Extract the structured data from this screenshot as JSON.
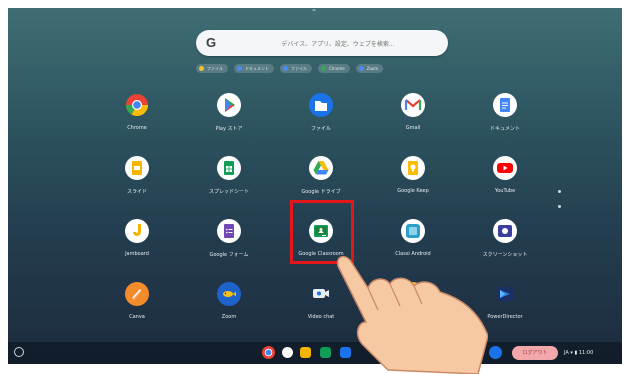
{
  "search": {
    "g_letter": "G",
    "placeholder": "デバイス、アプリ、設定、ウェブを検索..."
  },
  "chips": [
    {
      "label": "ファイル",
      "color": "#f6c026"
    },
    {
      "label": "ドキュメント",
      "color": "#4a8af4"
    },
    {
      "label": "ファイル",
      "color": "#4a8af4"
    },
    {
      "label": "Chrome",
      "color": "#34a853"
    },
    {
      "label": "Zoom",
      "color": "#4a8af4"
    }
  ],
  "apps": [
    {
      "name": "chrome",
      "label": "Chrome",
      "icon": "chrome-icon"
    },
    {
      "name": "play-store",
      "label": "Play ストア",
      "icon": "play-store-icon"
    },
    {
      "name": "files",
      "label": "ファイル",
      "icon": "files-icon"
    },
    {
      "name": "gmail",
      "label": "Gmail",
      "icon": "gmail-icon"
    },
    {
      "name": "docs",
      "label": "ドキュメント",
      "icon": "docs-icon"
    },
    {
      "name": "slides",
      "label": "スライド",
      "icon": "slides-icon"
    },
    {
      "name": "sheets",
      "label": "スプレッドシート",
      "icon": "sheets-icon"
    },
    {
      "name": "google-drive",
      "label": "Google ドライブ",
      "icon": "drive-icon"
    },
    {
      "name": "google-keep",
      "label": "Google Keep",
      "icon": "keep-icon"
    },
    {
      "name": "youtube",
      "label": "YouTube",
      "icon": "youtube-icon"
    },
    {
      "name": "jamboard",
      "label": "Jamboard",
      "icon": "jamboard-icon"
    },
    {
      "name": "google-forms",
      "label": "Google フォーム",
      "icon": "forms-icon"
    },
    {
      "name": "google-classroom",
      "label": "Google Classroom",
      "icon": "classroom-icon"
    },
    {
      "name": "classi",
      "label": "Classi Android",
      "icon": "classi-icon"
    },
    {
      "name": "screencastify",
      "label": "スクリーンショット",
      "icon": "screencast-icon"
    },
    {
      "name": "canva",
      "label": "Canva",
      "icon": "pencil-icon"
    },
    {
      "name": "zoom-fish",
      "label": "Zoom",
      "icon": "fish-icon"
    },
    {
      "name": "video-chat",
      "label": "Video chat",
      "icon": "video-icon"
    },
    {
      "name": "blank-app",
      "label": "",
      "icon": "yellow-circle-icon"
    },
    {
      "name": "powerdirector",
      "label": "PowerDirector",
      "icon": "powerdirector-icon"
    }
  ],
  "shelf": {
    "status_pill": "ログアウト",
    "status_text": "JA ▾ ▮ 11:00"
  },
  "colors": {
    "highlight": "#e3171b",
    "chrome_red": "#ea4335",
    "chrome_green": "#34a853",
    "chrome_yellow": "#fbbc05",
    "blue": "#4285f4"
  }
}
